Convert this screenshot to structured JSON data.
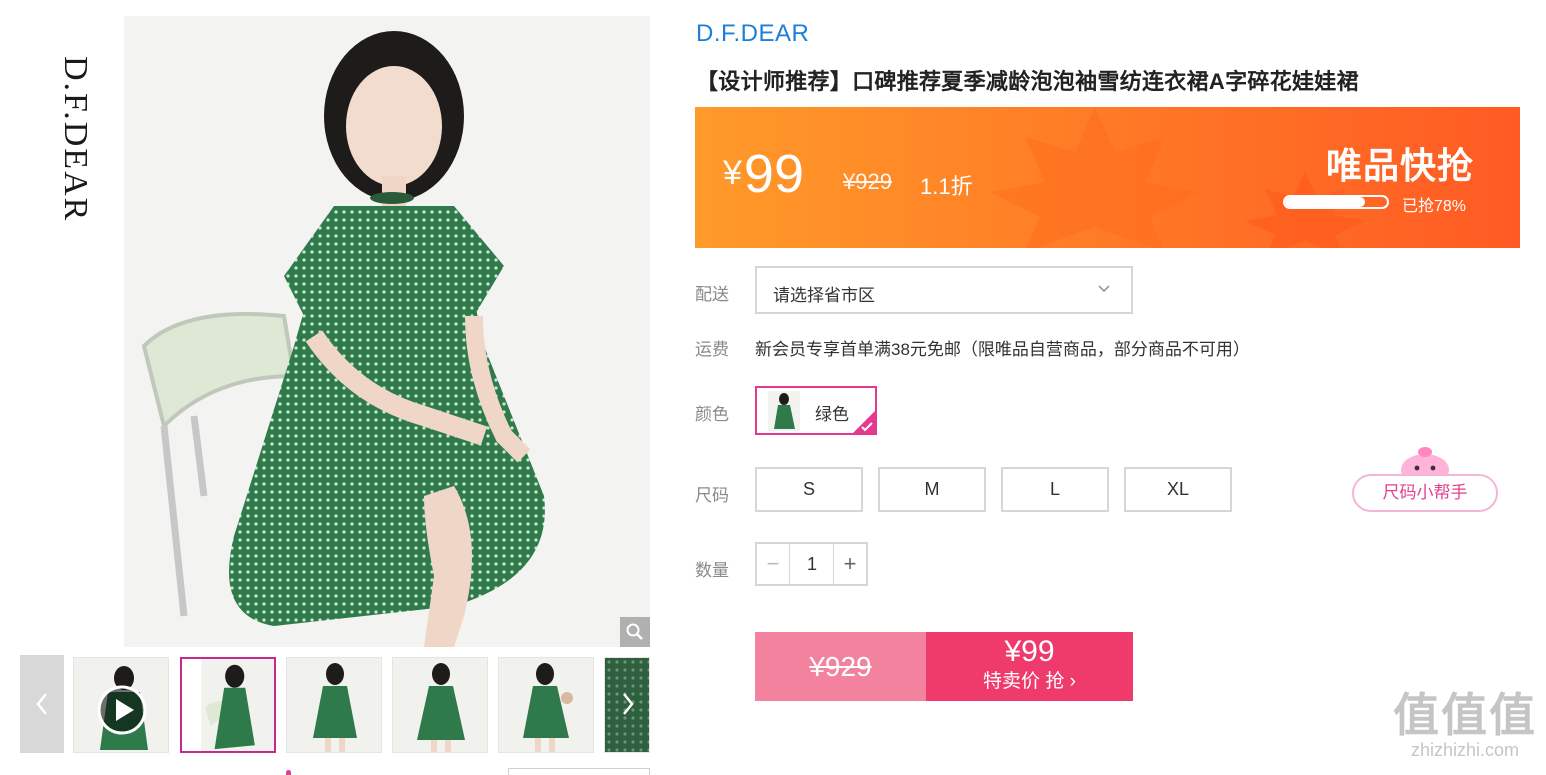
{
  "gallery": {
    "logo_text": "D.F.DEAR",
    "thumbnails": [
      "video",
      "image",
      "image",
      "image",
      "image",
      "image"
    ],
    "selected_index": 1
  },
  "product": {
    "brand": "D.F.DEAR",
    "title": "【设计师推荐】口碑推荐夏季减龄泡泡袖雪纺连衣裙A字碎花娃娃裙"
  },
  "price_banner": {
    "currency": "¥",
    "price": "99",
    "original_price": "¥929",
    "discount": "1.1折",
    "flash_title": "唯品快抢",
    "sold_percent": 78,
    "sold_text": "已抢78%",
    "colors": {
      "start": "#ff9a2a",
      "end": "#ff5a23"
    }
  },
  "delivery": {
    "label": "配送",
    "placeholder": "请选择省市区"
  },
  "shipping": {
    "label": "运费",
    "text": "新会员专享首单满38元免邮（限唯品自营商品，部分商品不可用）"
  },
  "color": {
    "label": "颜色",
    "options": [
      {
        "name": "绿色",
        "selected": true
      }
    ]
  },
  "size": {
    "label": "尺码",
    "options": [
      "S",
      "M",
      "L",
      "XL"
    ],
    "helper": "尺码小帮手"
  },
  "quantity": {
    "label": "数量",
    "value": "1",
    "minus": "−",
    "plus": "+"
  },
  "buy": {
    "original": "¥929",
    "price": "¥99",
    "action": "特卖价 抢 ›"
  },
  "watermark": {
    "big": "值值值",
    "small": "zhizhizhi.com"
  },
  "accent_colors": {
    "link_blue": "#1e7fd6",
    "pink": "#e4398f",
    "buy_red": "#ef3a6c"
  }
}
